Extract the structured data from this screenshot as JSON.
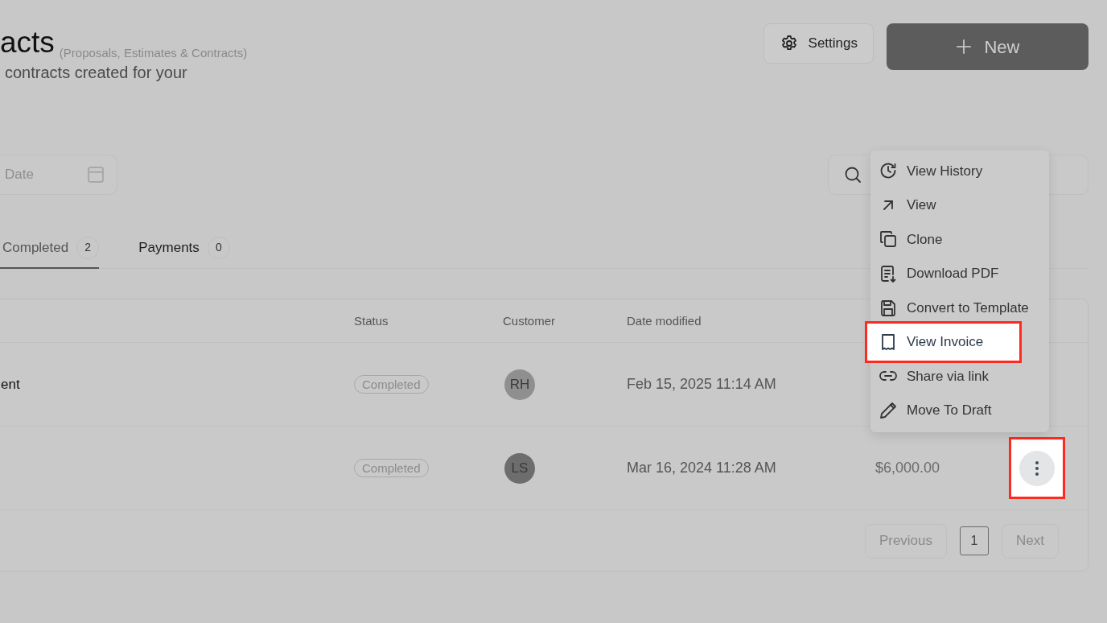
{
  "header": {
    "title": "acts",
    "title_note": "(Proposals, Estimates & Contracts)",
    "description": "contracts created for your",
    "settings_button": "Settings",
    "new_button": "New"
  },
  "filters": {
    "date_field": {
      "placeholder": "Date"
    }
  },
  "tabs": [
    {
      "label": "Completed",
      "count": "2",
      "selected": true
    },
    {
      "label": "Payments",
      "count": "0",
      "selected": false
    }
  ],
  "table": {
    "columns": [
      "Status",
      "Customer",
      "Date modified"
    ],
    "rows": [
      {
        "column_1": "ent",
        "status": "Completed",
        "customer": "RH",
        "color": "#8f8f8f",
        "date_modified": "Feb 15, 2025 11:14 AM",
        "actions_highlighted": false
      },
      {
        "status": "Completed",
        "customer": "LS",
        "color": "#6d6d6d",
        "date_modified": "Mar 16, 2024 11:28 AM",
        "amount": "$6,000.00",
        "actions_highlighted": true
      }
    ]
  },
  "context_menu": {
    "items": [
      {
        "label": "View History",
        "highlighted": false
      },
      {
        "label": "View",
        "highlighted": false
      },
      {
        "label": "Clone",
        "highlighted": false
      },
      {
        "label": "Download PDF",
        "highlighted": false
      },
      {
        "label": "Convert to Template",
        "highlighted": false
      },
      {
        "label": "View Invoice",
        "highlighted": true
      },
      {
        "label": "Share via link",
        "highlighted": false
      },
      {
        "label": "Move To Draft",
        "highlighted": false
      }
    ]
  },
  "pagination": {
    "previous": "Previous",
    "page": "1",
    "next": "Next"
  }
}
